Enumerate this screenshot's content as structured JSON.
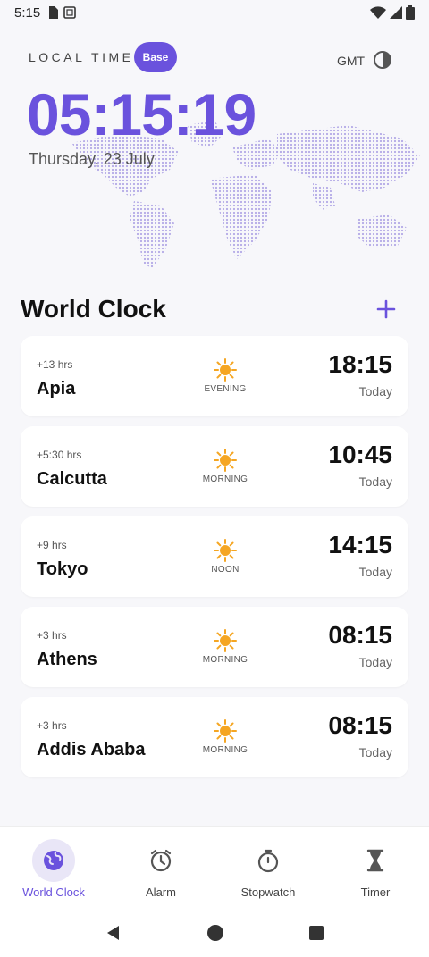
{
  "status_bar": {
    "time": "5:15"
  },
  "header": {
    "local_time_label": "LOCAL TIME",
    "base_label": "Base",
    "gmt_label": "GMT"
  },
  "local_clock": {
    "time": "05:15:19",
    "date": "Thursday, 23 July"
  },
  "section": {
    "title": "World Clock"
  },
  "clocks": [
    {
      "offset": "+13 hrs",
      "city": "Apia",
      "period": "EVENING",
      "time": "18:15",
      "day": "Today"
    },
    {
      "offset": "+5:30 hrs",
      "city": "Calcutta",
      "period": "MORNING",
      "time": "10:45",
      "day": "Today"
    },
    {
      "offset": "+9 hrs",
      "city": "Tokyo",
      "period": "NOON",
      "time": "14:15",
      "day": "Today"
    },
    {
      "offset": "+3 hrs",
      "city": "Athens",
      "period": "MORNING",
      "time": "08:15",
      "day": "Today"
    },
    {
      "offset": "+3 hrs",
      "city": "Addis Ababa",
      "period": "MORNING",
      "time": "08:15",
      "day": "Today"
    }
  ],
  "bottom_nav": [
    {
      "label": "World Clock",
      "icon": "globe-icon",
      "active": true
    },
    {
      "label": "Alarm",
      "icon": "alarm-icon",
      "active": false
    },
    {
      "label": "Stopwatch",
      "icon": "stopwatch-icon",
      "active": false
    },
    {
      "label": "Timer",
      "icon": "hourglass-icon",
      "active": false
    }
  ],
  "colors": {
    "accent": "#6a52dd",
    "sun": "#f5a623",
    "background": "#f7f7fa"
  }
}
